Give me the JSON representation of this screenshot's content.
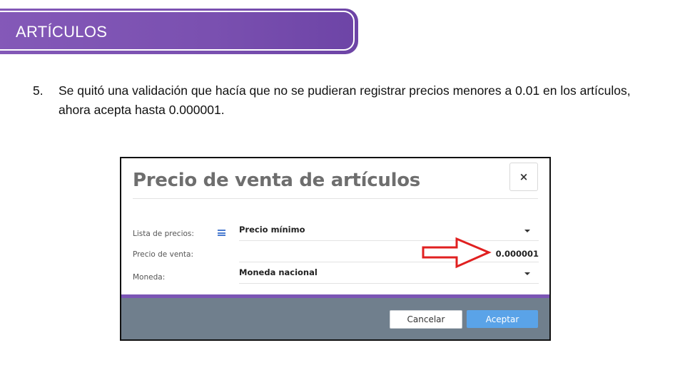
{
  "slide": {
    "title": "ARTÍCULOS",
    "note_number": "5.",
    "note_text": "Se quitó una validación que hacía que no se pudieran registrar precios menores a 0.01 en los artículos, ahora acepta hasta 0.000001."
  },
  "dialog": {
    "title": "Precio de venta de artículos",
    "close_symbol": "×",
    "fields": {
      "price_list": {
        "label": "Lista de precios:",
        "value": "Precio mínimo"
      },
      "sale_price": {
        "label": "Precio de venta:",
        "value": "0.000001"
      },
      "currency": {
        "label": "Moneda:",
        "value": "Moneda nacional"
      }
    },
    "buttons": {
      "cancel": "Cancelar",
      "accept": "Aceptar"
    }
  },
  "colors": {
    "banner": "#7a50b0",
    "footer": "#707f8d",
    "accept_button": "#5aa3e8",
    "arrow": "#e02020"
  }
}
